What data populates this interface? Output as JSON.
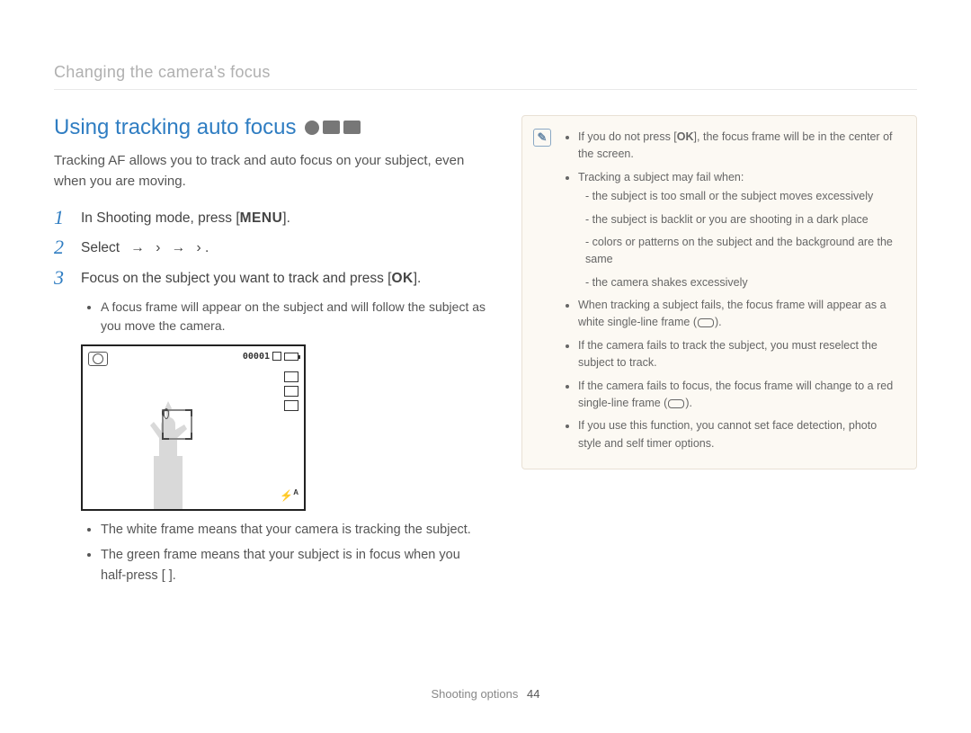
{
  "breadcrumb": "Changing the camera's focus",
  "section_title": "Using tracking auto focus",
  "intro": "Tracking AF allows you to track and auto focus on your subject, even when you are moving.",
  "steps": {
    "s1": {
      "num": "1",
      "pre": "In Shooting mode, press [",
      "key": "MENU",
      "post": "]."
    },
    "s2": {
      "num": "2",
      "pre": "Select",
      "arrow": "→",
      "sep": "›",
      "post": "."
    },
    "s3": {
      "num": "3",
      "pre": "Focus on the subject you want to track and press [",
      "key": "OK",
      "post": "]."
    }
  },
  "sub_after_step3": [
    "A focus frame will appear on the subject and will follow the subject as you move the camera."
  ],
  "screen": {
    "counter": "00001"
  },
  "after_screen_bullets": [
    "The white frame means that your camera is tracking the subject.",
    "The green frame means that your subject is in focus when you half-press [            ]."
  ],
  "notes": {
    "n1_pre": "If you do not press [",
    "n1_key": "OK",
    "n1_post": "], the focus frame will be in the center of the screen.",
    "n2": "Tracking a subject may fail when:",
    "n2_sub": [
      "the subject is too small or the subject moves excessively",
      "the subject is backlit or you are shooting in a dark place",
      "colors or patterns on the subject and the background are the same",
      "the camera shakes excessively"
    ],
    "n3_pre": "When tracking a subject fails, the focus frame will appear as a white single-line frame (",
    "n3_post": ").",
    "n4": "If the camera fails to track the subject, you must reselect the subject to track.",
    "n5_pre": "If the camera fails to focus, the focus frame will change to a red single-line frame (",
    "n5_post": ").",
    "n6": "If you use this function, you cannot set face detection, photo style and self timer options."
  },
  "footer": {
    "section": "Shooting options",
    "page": "44"
  }
}
